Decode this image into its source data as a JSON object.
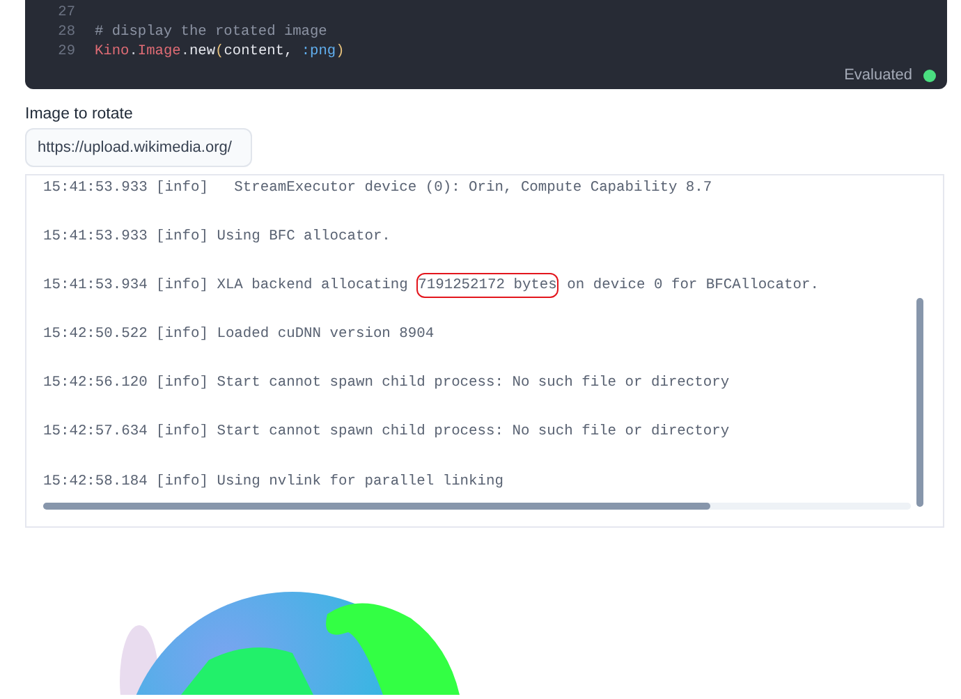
{
  "code_cell": {
    "lines": [
      {
        "number": "27"
      },
      {
        "number": "28",
        "tokens": [
          {
            "kind": "comment",
            "text": "# display the rotated image"
          }
        ]
      },
      {
        "number": "29",
        "tokens": [
          {
            "kind": "module",
            "text": "Kino"
          },
          {
            "kind": "punct",
            "text": "."
          },
          {
            "kind": "module",
            "text": "Image"
          },
          {
            "kind": "punct",
            "text": "."
          },
          {
            "kind": "func",
            "text": "new"
          },
          {
            "kind": "paren",
            "text": "("
          },
          {
            "kind": "ident",
            "text": "content, "
          },
          {
            "kind": "atom",
            "text": ":png"
          },
          {
            "kind": "paren",
            "text": ")"
          }
        ]
      }
    ],
    "status": {
      "label": "Evaluated",
      "color": "#4ade80"
    }
  },
  "input": {
    "label": "Image to rotate",
    "value": "https://upload.wikimedia.org/"
  },
  "log": {
    "lines": [
      {
        "segments": [
          {
            "text": "15:41:53.933 [info]   StreamExecutor device (0): Orin, Compute Capability 8.7",
            "circled": false
          }
        ]
      },
      {
        "segments": [
          {
            "text": "15:41:53.933 [info] Using BFC allocator.",
            "circled": false
          }
        ]
      },
      {
        "segments": [
          {
            "text": "15:41:53.934 [info] XLA backend allocating ",
            "circled": false
          },
          {
            "text": "7191252172 bytes",
            "circled": true
          },
          {
            "text": " on device 0 for BFCAllocator.",
            "circled": false
          }
        ]
      },
      {
        "segments": [
          {
            "text": "15:42:50.522 [info] Loaded cuDNN version 8904",
            "circled": false
          }
        ]
      },
      {
        "segments": [
          {
            "text": "15:42:56.120 [info] Start cannot spawn child process: No such file or directory",
            "circled": false
          }
        ]
      },
      {
        "segments": [
          {
            "text": "15:42:57.634 [info] Start cannot spawn child process: No such file or directory",
            "circled": false
          }
        ]
      },
      {
        "segments": [
          {
            "text": "15:42:58.184 [info] Using nvlink for parallel linking",
            "circled": false
          }
        ]
      }
    ]
  }
}
